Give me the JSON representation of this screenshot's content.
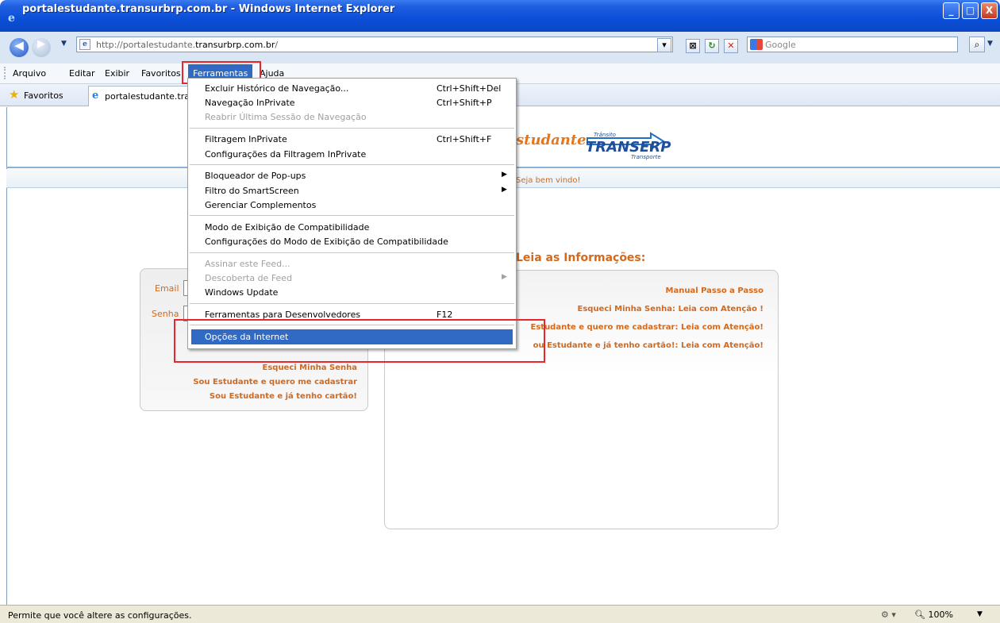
{
  "window": {
    "title": "portalestudante.transurbrp.com.br - Windows Internet Explorer",
    "minimize": "_",
    "maximize": "□",
    "close": "X"
  },
  "address": {
    "url_prefix": "http://portalestudante.",
    "url_domain": "transurbrp.com.br",
    "url_suffix": "/",
    "search_placeholder": "Google"
  },
  "menubar": {
    "items": [
      "Arquivo",
      "Editar",
      "Exibir",
      "Favoritos",
      "Ferramentas",
      "Ajuda"
    ],
    "active": "Ferramentas"
  },
  "favorites": {
    "label": "Favoritos",
    "tab_title": "portalestudante.transurbrp.com.br"
  },
  "tools_menu": {
    "items": [
      {
        "label": "Excluir Histórico de Navegação...",
        "shortcut": "Ctrl+Shift+Del",
        "enabled": true
      },
      {
        "label": "Navegação InPrivate",
        "shortcut": "Ctrl+Shift+P",
        "enabled": true
      },
      {
        "label": "Reabrir Última Sessão de Navegação",
        "shortcut": "",
        "enabled": false
      },
      {
        "label": "Filtragem InPrivate",
        "shortcut": "Ctrl+Shift+F",
        "enabled": true
      },
      {
        "label": "Configurações da Filtragem InPrivate",
        "shortcut": "",
        "enabled": true
      },
      {
        "label": "Bloqueador de Pop-ups",
        "shortcut": "",
        "enabled": true,
        "submenu": true
      },
      {
        "label": "Filtro do SmartScreen",
        "shortcut": "",
        "enabled": true,
        "submenu": true
      },
      {
        "label": "Gerenciar Complementos",
        "shortcut": "",
        "enabled": true
      },
      {
        "label": "Modo de Exibição de Compatibilidade",
        "shortcut": "",
        "enabled": true
      },
      {
        "label": "Configurações do Modo de Exibição de Compatibilidade",
        "shortcut": "",
        "enabled": true
      },
      {
        "label": "Assinar este Feed...",
        "shortcut": "",
        "enabled": false
      },
      {
        "label": "Descoberta de Feed",
        "shortcut": "",
        "enabled": false,
        "submenu": true
      },
      {
        "label": "Windows Update",
        "shortcut": "",
        "enabled": true
      },
      {
        "label": "Ferramentas para Desenvolvedores",
        "shortcut": "F12",
        "enabled": true
      },
      {
        "label": "Opções da Internet",
        "shortcut": "",
        "enabled": true,
        "highlighted": true
      }
    ]
  },
  "site": {
    "logo_script": "studante",
    "logo_brand": "TRANSERP",
    "logo_transito": "Trânsito",
    "logo_transporte": "Transporte",
    "welcome": "Seja bem vindo!",
    "info_title": "Leia as Informações:",
    "info_links": [
      "Manual Passo a Passo",
      "Esqueci Minha Senha: Leia com Atenção !",
      "Estudante e quero me cadastrar: Leia com Atenção!",
      "ou Estudante e já tenho cartão!: Leia com Atenção!"
    ],
    "login": {
      "email_label": "Email",
      "senha_label": "Senha",
      "links": [
        "Esqueci Minha Senha",
        "Sou Estudante e quero me cadastrar",
        "Sou Estudante e já tenho cartão!"
      ]
    }
  },
  "status": {
    "text": "Permite que você altere as configurações.",
    "zoom": "100%"
  },
  "colors": {
    "accent": "#d2691e",
    "menu_highlight": "#316ac5",
    "callout": "#e8262c"
  }
}
